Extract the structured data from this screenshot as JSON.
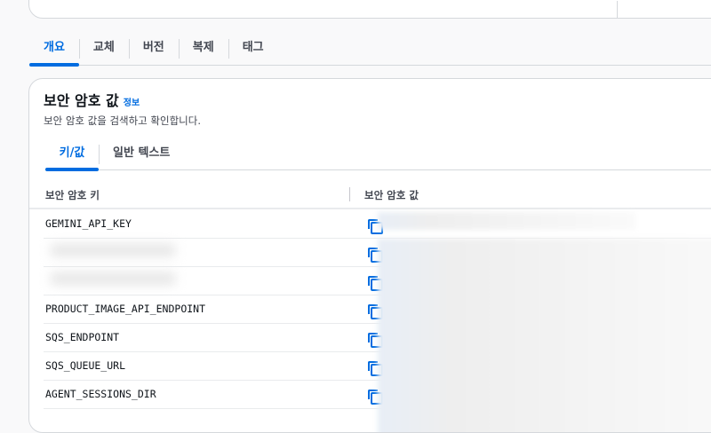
{
  "tabs": [
    "개요",
    "교체",
    "버전",
    "복제",
    "태그"
  ],
  "panel": {
    "title": "보안 암호 값",
    "info": "정보",
    "description": "보안 암호 값을 검색하고 확인합니다.",
    "tabs": [
      "키/값",
      "일반 텍스트"
    ]
  },
  "table": {
    "headers": [
      "보안 암호 키",
      "보안 암호 값"
    ],
    "rows": [
      {
        "key": "GEMINI_API_KEY"
      },
      {
        "key": ""
      },
      {
        "key": ""
      },
      {
        "key": "PRODUCT_IMAGE_API_ENDPOINT"
      },
      {
        "key": "SQS_ENDPOINT"
      },
      {
        "key": "SQS_QUEUE_URL"
      },
      {
        "key": "AGENT_SESSIONS_DIR"
      }
    ]
  },
  "colors": {
    "accent": "#006ce0"
  }
}
